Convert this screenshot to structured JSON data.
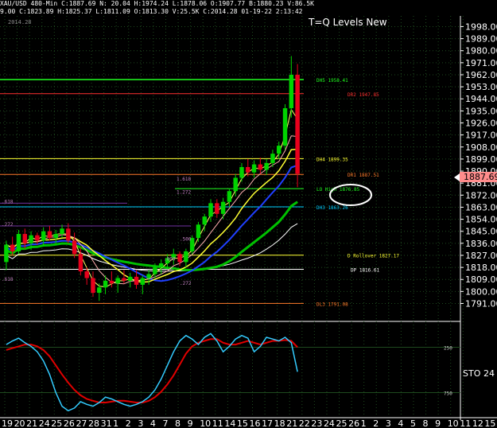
{
  "header": {
    "line1": "XAU/USD 480-Min  C:1887.69  N: 20.04  H:1974.24  L:1878.06  O:1907.77  B:1880.23  V:86.5K",
    "line2": "9.00  C:1823.89  H:1825.37  L:1811.09  O:1813.30  V:25.5K  C:2014.28  01-19-22  2:13:42"
  },
  "chart_title": "T=Q Levels New",
  "date_tag": "2014.28",
  "price_label": "1887.69",
  "sto_label": "STO",
  "sto_value": "24",
  "colors": {
    "grid": "#1e4a1e",
    "up": "#00d400",
    "down": "#e8001c",
    "green_level": "#20ff20",
    "yellow_level": "#ffff33",
    "cyan_level": "#00ccff",
    "orange_level": "#ff7a2a",
    "price_box": "#ff8c8c"
  },
  "chart_data": {
    "type": "candlestick",
    "y_ticks": [
      1998.0,
      1989.0,
      1980.0,
      1971.0,
      1962.0,
      1953.0,
      1944.0,
      1935.0,
      1926.0,
      1917.0,
      1908.0,
      1899.0,
      1890.0,
      1881.0,
      1872.0,
      1863.0,
      1854.0,
      1845.0,
      1836.0,
      1827.0,
      1818.0,
      1809.0,
      1800.0,
      1791.0
    ],
    "y_tick_labels": [
      "1998.00",
      "1989.00",
      "1980.00",
      "1971.00",
      "1962.00",
      "1953.00",
      "1944.00",
      "1935.00",
      "1926.00",
      "1917.00",
      "1908.00",
      "1899.00",
      "1890.00",
      "1881.00",
      "1872.00",
      "1863.00",
      "1854.00",
      "1845.00",
      "1836.00",
      "1827.00",
      "1818.00",
      "1809.00",
      "1800.00",
      "1791.00"
    ],
    "ylim": [
      1780,
      2006
    ],
    "x_labels": [
      "19",
      "20",
      "21",
      "24",
      "25",
      "26",
      "27",
      "28",
      "31",
      "1",
      "2",
      "3",
      "4",
      "7",
      "8",
      "9",
      "10",
      "11",
      "14",
      "15",
      "16",
      "17",
      "18",
      "21",
      "22",
      "23",
      "24",
      "25",
      "26",
      "1",
      "2",
      "3",
      "4",
      "5",
      "8",
      "9",
      "10",
      "11",
      "12",
      "15"
    ],
    "level_lines": [
      {
        "label": "DH5 1958.41",
        "price": 1958.41,
        "color": "#20ff20"
      },
      {
        "label": "DR2 1947.85",
        "price": 1947.85,
        "color": "#ff3030"
      },
      {
        "label": "DH4 1899.35",
        "price": 1899.35,
        "color": "#ffff33"
      },
      {
        "label": "DR1 1887.51",
        "price": 1887.51,
        "color": "#ff7a2a"
      },
      {
        "label": "LO High 1876.85",
        "price": 1876.85,
        "color": "#20ff20"
      },
      {
        "label": "DH3 1863.26",
        "price": 1863.26,
        "color": "#00ccff"
      },
      {
        "label": "D Rollover 1827.17",
        "price": 1827.17,
        "color": "#ffff33"
      },
      {
        "label": "DP 1816.61",
        "price": 1816.61,
        "color": "#ffffff"
      },
      {
        "label": "DL3 1791.08",
        "price": 1791.08,
        "color": "#ff7a2a"
      }
    ],
    "fib_labels": [
      {
        "label": "1.618",
        "price": 1883
      },
      {
        "label": "1.272",
        "price": 1873
      },
      {
        "label": ".618",
        "price": 1866
      },
      {
        "label": ".272",
        "price": 1849
      },
      {
        "label": ".500",
        "price": 1838
      },
      {
        "label": ".000",
        "price": 1823
      },
      {
        "label": ".618",
        "price": 1808
      },
      {
        "label": ".272",
        "price": 1805
      }
    ],
    "candles": [
      [
        1822,
        1838,
        1816,
        1835
      ],
      [
        1835,
        1841,
        1827,
        1830
      ],
      [
        1830,
        1846,
        1828,
        1843
      ],
      [
        1843,
        1847,
        1832,
        1836
      ],
      [
        1836,
        1845,
        1831,
        1842
      ],
      [
        1842,
        1844,
        1835,
        1838
      ],
      [
        1838,
        1848,
        1834,
        1845
      ],
      [
        1845,
        1849,
        1838,
        1840
      ],
      [
        1840,
        1846,
        1835,
        1843
      ],
      [
        1843,
        1850,
        1840,
        1847
      ],
      [
        1847,
        1851,
        1836,
        1838
      ],
      [
        1838,
        1844,
        1825,
        1828
      ],
      [
        1828,
        1833,
        1812,
        1815
      ],
      [
        1815,
        1818,
        1805,
        1810
      ],
      [
        1810,
        1815,
        1796,
        1799
      ],
      [
        1799,
        1806,
        1793,
        1803
      ],
      [
        1803,
        1812,
        1798,
        1808
      ],
      [
        1808,
        1815,
        1803,
        1806
      ],
      [
        1806,
        1812,
        1799,
        1810
      ],
      [
        1810,
        1816,
        1806,
        1808
      ],
      [
        1808,
        1814,
        1803,
        1811
      ],
      [
        1811,
        1816,
        1802,
        1805
      ],
      [
        1805,
        1812,
        1798,
        1810
      ],
      [
        1810,
        1816,
        1805,
        1813
      ],
      [
        1813,
        1821,
        1810,
        1818
      ],
      [
        1818,
        1824,
        1813,
        1821
      ],
      [
        1821,
        1828,
        1817,
        1825
      ],
      [
        1825,
        1832,
        1820,
        1828
      ],
      [
        1828,
        1830,
        1819,
        1822
      ],
      [
        1822,
        1832,
        1818,
        1830
      ],
      [
        1830,
        1842,
        1828,
        1840
      ],
      [
        1840,
        1852,
        1837,
        1850
      ],
      [
        1850,
        1858,
        1845,
        1856
      ],
      [
        1856,
        1869,
        1852,
        1866
      ],
      [
        1866,
        1869,
        1855,
        1858
      ],
      [
        1858,
        1870,
        1854,
        1867
      ],
      [
        1867,
        1877,
        1863,
        1875
      ],
      [
        1875,
        1888,
        1871,
        1885
      ],
      [
        1885,
        1896,
        1882,
        1893
      ],
      [
        1893,
        1899,
        1886,
        1889
      ],
      [
        1889,
        1898,
        1885,
        1895
      ],
      [
        1895,
        1900,
        1888,
        1891
      ],
      [
        1891,
        1899,
        1887,
        1896
      ],
      [
        1896,
        1906,
        1893,
        1903
      ],
      [
        1903,
        1912,
        1899,
        1909
      ],
      [
        1909,
        1940,
        1906,
        1937
      ],
      [
        1937,
        1976,
        1930,
        1962
      ],
      [
        1962,
        1970,
        1878,
        1888
      ]
    ],
    "oscillator": {
      "name": "STO",
      "ylim": [
        0,
        100
      ],
      "levels": [
        75,
        25
      ],
      "level_labels": [
        "250",
        "750"
      ],
      "k_line": [
        78,
        82,
        85,
        80,
        76,
        70,
        60,
        45,
        25,
        10,
        5,
        8,
        15,
        12,
        10,
        14,
        20,
        18,
        15,
        12,
        10,
        12,
        15,
        20,
        28,
        40,
        55,
        70,
        82,
        88,
        84,
        78,
        86,
        90,
        82,
        70,
        76,
        84,
        88,
        85,
        70,
        76,
        86,
        84,
        82,
        86,
        80,
        48
      ],
      "d_line": [
        72,
        74,
        76,
        78,
        78,
        76,
        72,
        65,
        55,
        45,
        36,
        28,
        22,
        18,
        16,
        14,
        14,
        15,
        16,
        16,
        15,
        14,
        14,
        16,
        20,
        26,
        34,
        44,
        56,
        68,
        76,
        80,
        82,
        84,
        84,
        80,
        78,
        78,
        80,
        82,
        80,
        78,
        80,
        82,
        82,
        83,
        82,
        75
      ]
    }
  }
}
